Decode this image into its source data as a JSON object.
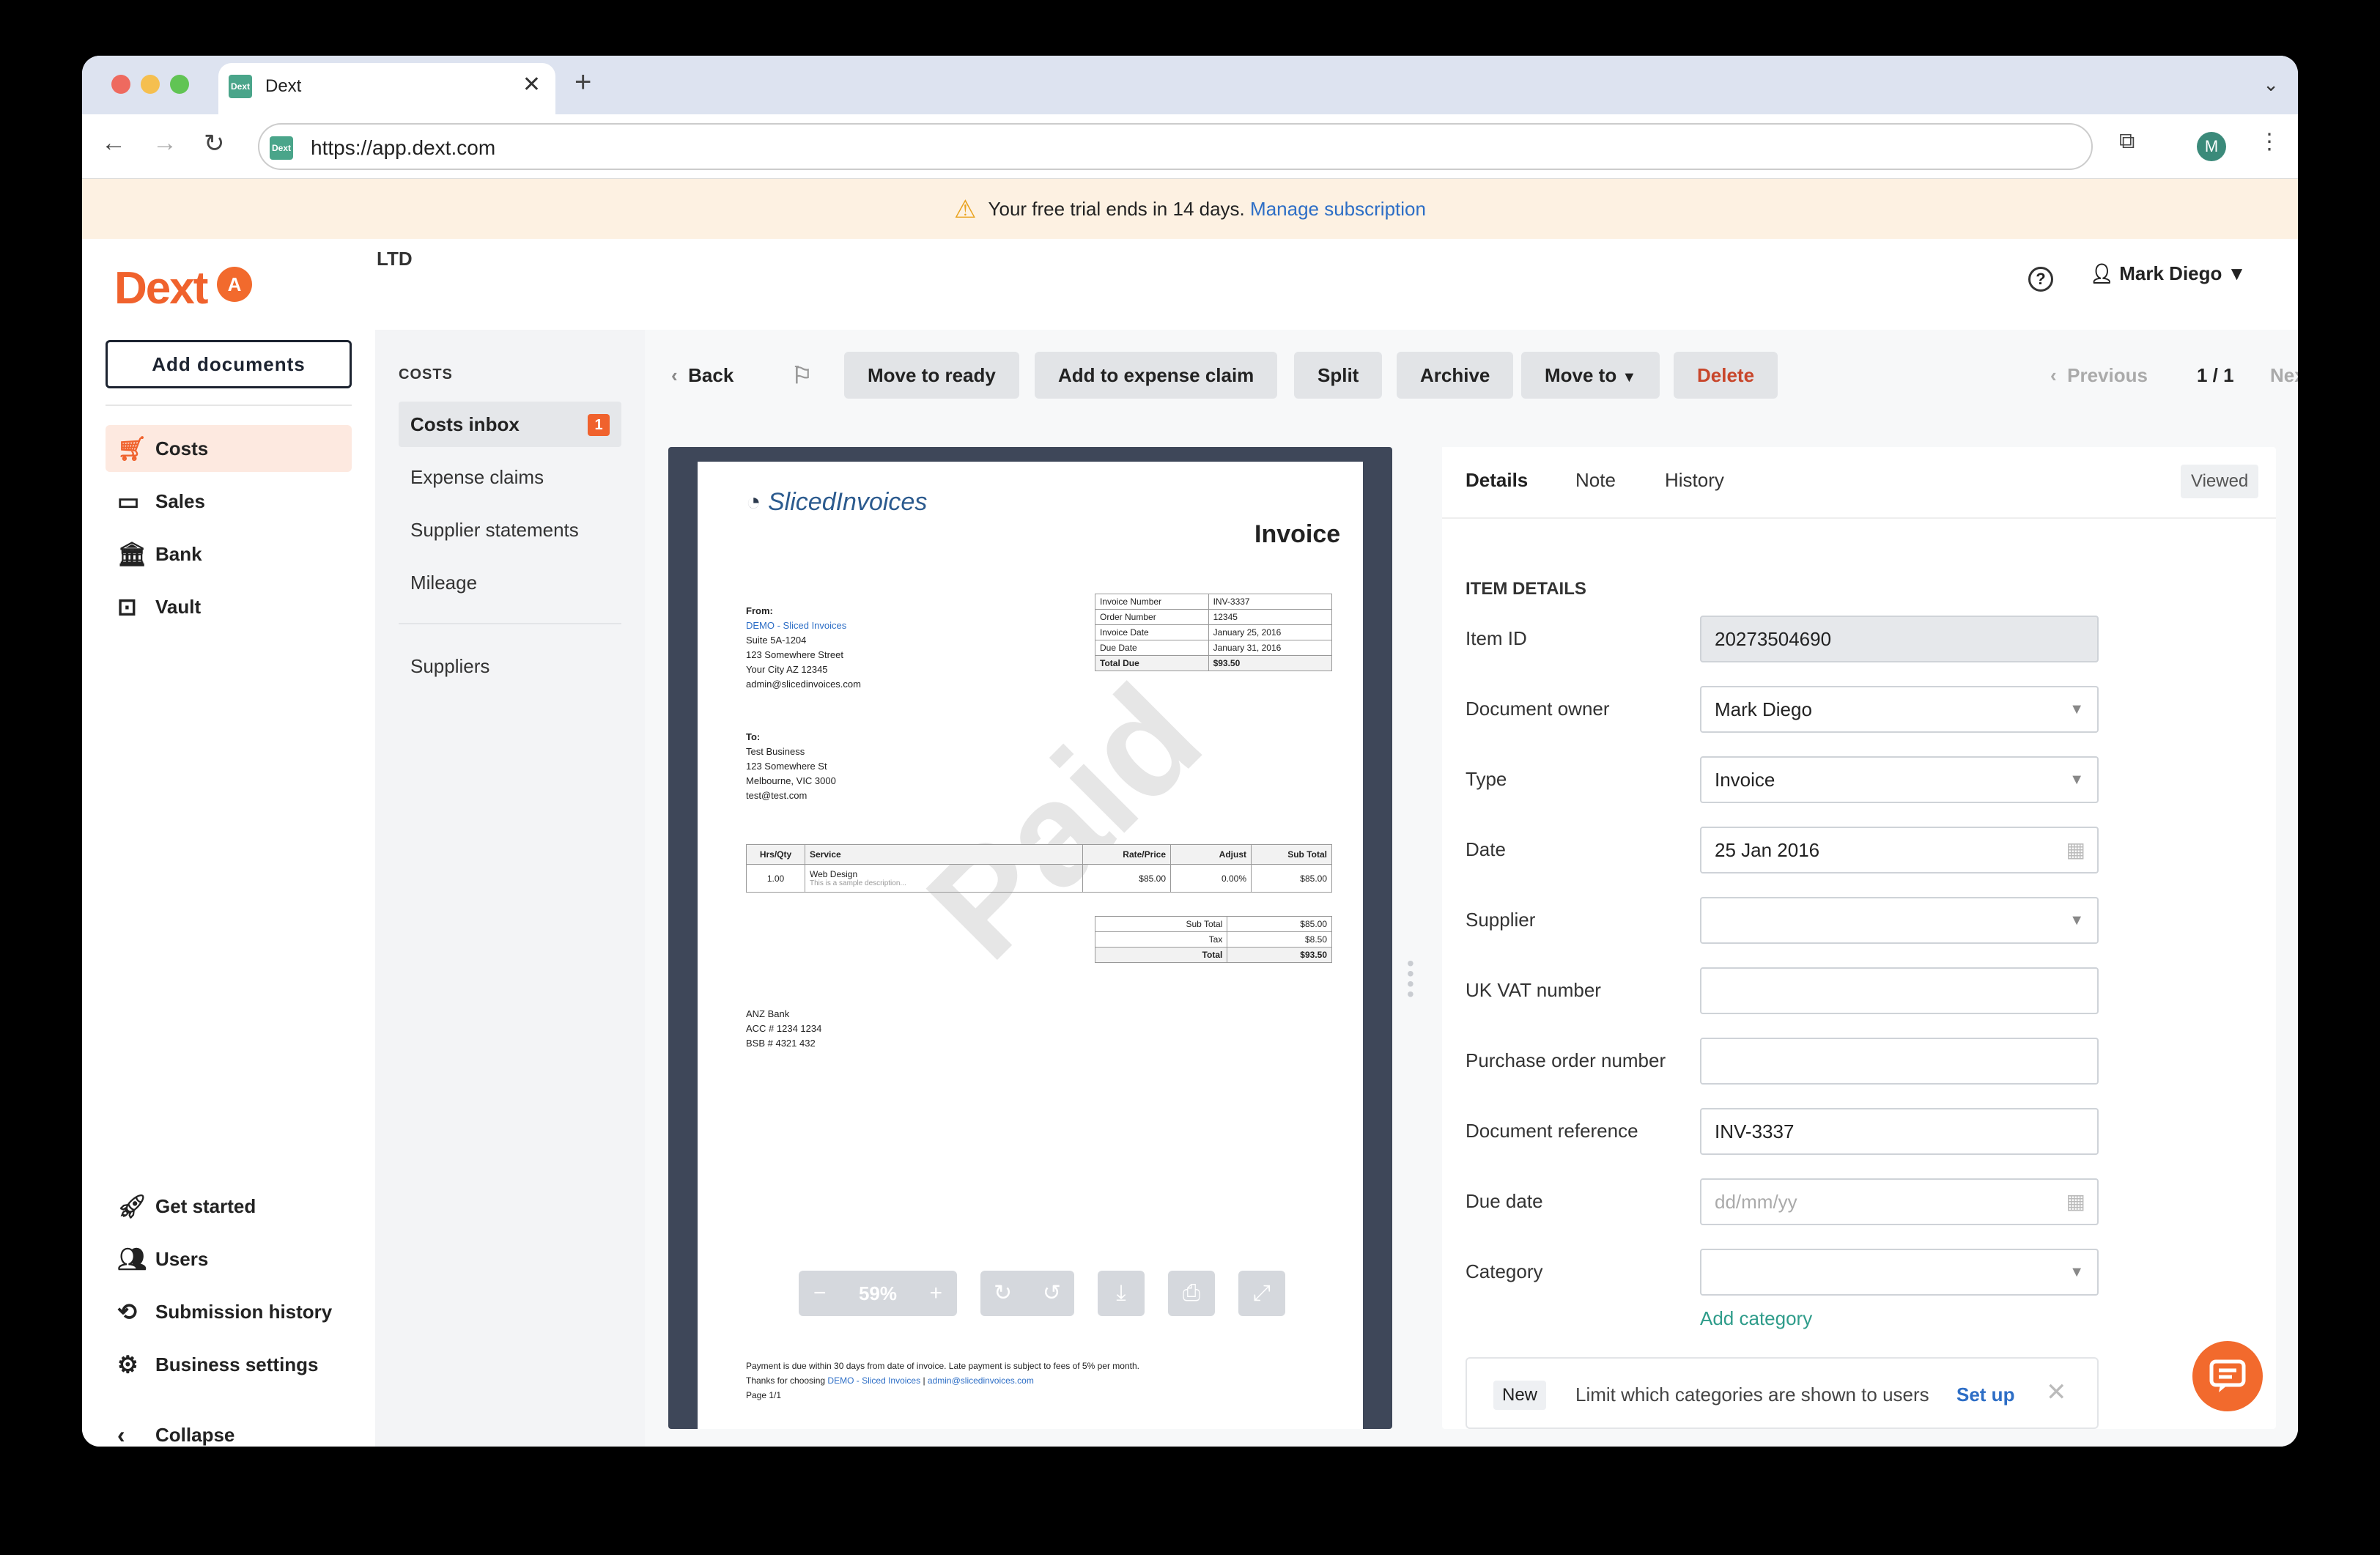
{
  "browser": {
    "tab_title": "Dext",
    "favicon": "Dext",
    "url": "https://app.dext.com",
    "profile_initial": "M"
  },
  "banner": {
    "text": "Your free trial ends in 14 days.",
    "link": "Manage subscription"
  },
  "brand": {
    "logo": "Dext",
    "org_initial": "A",
    "org_name": "LTD",
    "accent": "#f0622d"
  },
  "sidebar": {
    "add_documents": "Add documents",
    "items": [
      "Costs",
      "Sales",
      "Bank",
      "Vault"
    ],
    "bottom": [
      "Get started",
      "Users",
      "Submission history",
      "Business settings",
      "Collapse"
    ]
  },
  "header": {
    "user_name": "Mark Diego"
  },
  "subnav": {
    "header": "COSTS",
    "items": [
      "Costs inbox",
      "Expense claims",
      "Supplier statements",
      "Mileage",
      "Suppliers"
    ],
    "inbox_count": "1"
  },
  "toolbar": {
    "back": "Back",
    "move_to_ready": "Move to ready",
    "add_expense": "Add to expense claim",
    "split": "Split",
    "archive": "Archive",
    "move_to": "Move to",
    "delete": "Delete",
    "previous": "Previous",
    "pager": "1 / 1",
    "next": "Next"
  },
  "viewer": {
    "zoom": "59%"
  },
  "invoice": {
    "brand": "SlicedInvoices",
    "title": "Invoice",
    "watermark": "Paid",
    "from_label": "From:",
    "from_name": "DEMO - Sliced Invoices",
    "from_lines": [
      "Suite 5A-1204",
      "123 Somewhere Street",
      "Your City AZ 12345",
      "admin@slicedinvoices.com"
    ],
    "to_label": "To:",
    "to_lines": [
      "Test Business",
      "123 Somewhere St",
      "Melbourne, VIC 3000",
      "test@test.com"
    ],
    "meta": [
      [
        "Invoice Number",
        "INV-3337"
      ],
      [
        "Order Number",
        "12345"
      ],
      [
        "Invoice Date",
        "January 25, 2016"
      ],
      [
        "Due Date",
        "January 31, 2016"
      ],
      [
        "Total Due",
        "$93.50"
      ]
    ],
    "items_head": [
      "Hrs/Qty",
      "Service",
      "Rate/Price",
      "Adjust",
      "Sub Total"
    ],
    "items_row": [
      "1.00",
      "Web Design",
      "$85.00",
      "0.00%",
      "$85.00"
    ],
    "item_desc": "This is a sample description...",
    "totals": [
      [
        "Sub Total",
        "$85.00"
      ],
      [
        "Tax",
        "$8.50"
      ],
      [
        "Total",
        "$93.50"
      ]
    ],
    "bank": [
      "ANZ Bank",
      "ACC # 1234 1234",
      "BSB # 4321 432"
    ],
    "footer1": "Payment is due within 30 days from date of invoice. Late payment is subject to fees of 5% per month.",
    "footer2a": "Thanks for choosing ",
    "footer2b": "DEMO - Sliced Invoices",
    "footer2c": " | ",
    "footer2d": "admin@slicedinvoices.com",
    "page": "Page 1/1"
  },
  "panel": {
    "tabs": [
      "Details",
      "Note",
      "History"
    ],
    "viewed": "Viewed",
    "section": "ITEM DETAILS",
    "fields": {
      "item_id_label": "Item ID",
      "item_id": "20273504690",
      "owner_label": "Document owner",
      "owner": "Mark Diego",
      "type_label": "Type",
      "type": "Invoice",
      "date_label": "Date",
      "date": "25 Jan 2016",
      "supplier_label": "Supplier",
      "vat_label": "UK VAT number",
      "po_label": "Purchase order number",
      "ref_label": "Document reference",
      "ref": "INV-3337",
      "due_label": "Due date",
      "due_placeholder": "dd/mm/yy",
      "category_label": "Category"
    },
    "add_category": "Add category",
    "new_tag": "New",
    "new_text": "Limit which categories are shown to users",
    "setup": "Set up"
  }
}
